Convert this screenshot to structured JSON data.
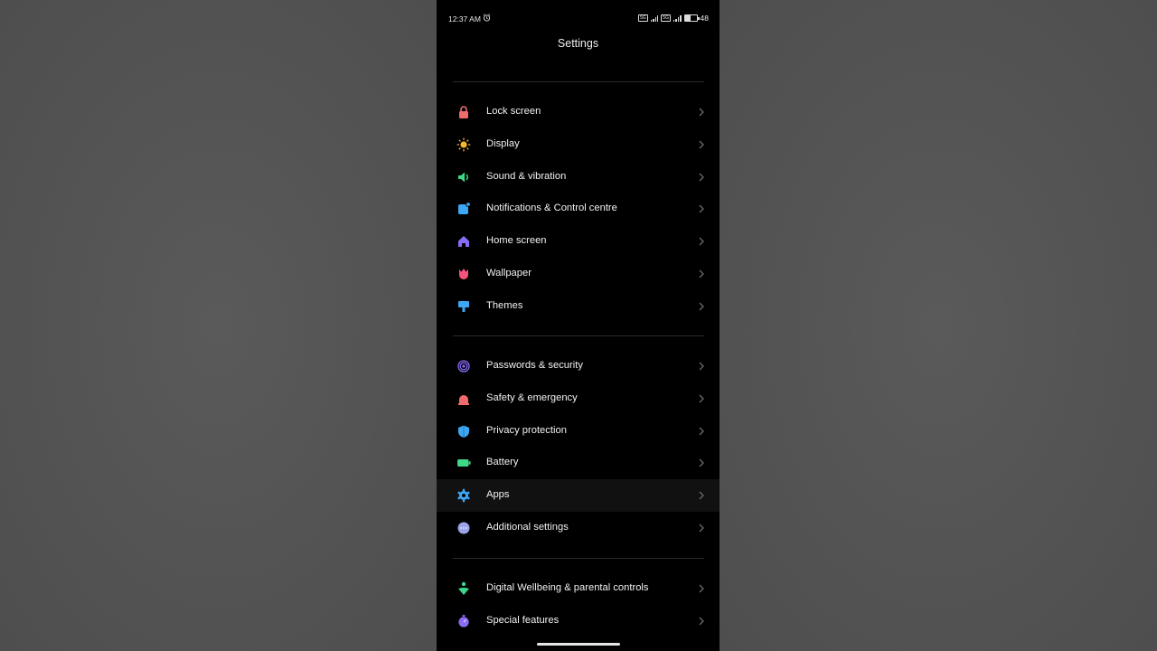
{
  "status_bar": {
    "time": "12:37 AM",
    "network_label": "5G",
    "battery_percent": "48",
    "battery_level": 0.48
  },
  "header": {
    "title": "Settings"
  },
  "groups": [
    {
      "items": [
        {
          "label": "Lock screen",
          "icon": "lock-icon",
          "color": "#f26b6b"
        },
        {
          "label": "Display",
          "icon": "sun-icon",
          "color": "#f5b82e"
        },
        {
          "label": "Sound & vibration",
          "icon": "speaker-icon",
          "color": "#3fd68a"
        },
        {
          "label": "Notifications & Control centre",
          "icon": "notification-icon",
          "color": "#3ea7f5"
        },
        {
          "label": "Home screen",
          "icon": "home-icon",
          "color": "#8a6bf5"
        },
        {
          "label": "Wallpaper",
          "icon": "tulip-icon",
          "color": "#f2557a"
        },
        {
          "label": "Themes",
          "icon": "brush-icon",
          "color": "#3ea7f5"
        }
      ]
    },
    {
      "items": [
        {
          "label": "Passwords & security",
          "icon": "fingerprint-icon",
          "color": "#8a6bf5"
        },
        {
          "label": "Safety & emergency",
          "icon": "siren-icon",
          "color": "#f26b6b"
        },
        {
          "label": "Privacy protection",
          "icon": "shield-icon",
          "color": "#3ea7f5"
        },
        {
          "label": "Battery",
          "icon": "battery-icon",
          "color": "#3fd68a"
        },
        {
          "label": "Apps",
          "icon": "gear-icon",
          "color": "#3ea7f5"
        },
        {
          "label": "Additional settings",
          "icon": "dots-icon",
          "color": "#9aa6e8"
        }
      ]
    },
    {
      "items": [
        {
          "label": "Digital Wellbeing & parental controls",
          "icon": "wellbeing-icon",
          "color": "#3fd68a"
        },
        {
          "label": "Special features",
          "icon": "stopwatch-icon",
          "color": "#8a6bf5"
        }
      ]
    }
  ]
}
